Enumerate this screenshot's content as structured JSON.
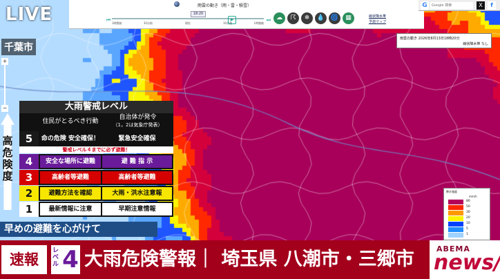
{
  "overlay": {
    "live_label": "LIVE",
    "city_label": "千葉市",
    "vertical_text": [
      "高",
      "危",
      "険",
      "度"
    ],
    "early_evacuation": "早めの避難を心がけて"
  },
  "toolbar": {
    "title": "雨雲の動き（雨・雷・積雪）",
    "time_value": "18:20",
    "time_ticks": [
      "1時間前",
      "",
      "30分前",
      "",
      "",
      "現在",
      "",
      "",
      "30分後",
      "",
      "1時間後"
    ],
    "icons": [
      {
        "name": "rain-cloud-icon",
        "glyph": "☁",
        "style": "green"
      },
      {
        "name": "thunder-cloud-icon",
        "glyph": "☈",
        "style": "dark"
      },
      {
        "name": "snow-depth-icon",
        "glyph": "❄",
        "style": "dark"
      },
      {
        "name": "raindrop-icon",
        "glyph": "💧",
        "style": "dark"
      },
      {
        "name": "typhoon-icon",
        "glyph": "🌀",
        "style": "dark"
      },
      {
        "name": "radar-grid-icon",
        "glyph": "▦",
        "style": "green"
      }
    ],
    "links": [
      "線状降水帯",
      "予測マップ"
    ]
  },
  "search": {
    "placeholder": "Google 検索",
    "google_glyph": "G",
    "x_glyph": "X",
    "facebook_glyph": "f"
  },
  "infobox": {
    "line1": "雨雲の動き  2026年8月13日18時20分",
    "line2": "線状降水帯  なし"
  },
  "warning_table": {
    "title": "大雨警戒レベル",
    "col_action": "住民がとるべき行動",
    "col_authority": "自治体が発令",
    "col_authority_note": "（1，2は気象庁発表）",
    "note": "警戒レベル４までに必ず避難！",
    "rows": [
      {
        "level": "5",
        "action": "命の危険 安全確保！",
        "issued": "緊急安全確保",
        "num_bg": "#1a1a1a",
        "num_fg": "#ffffff",
        "cell_bg": "#111111",
        "cell_fg": "#ffffff"
      },
      {
        "level": "4",
        "action": "安全な場所に避難",
        "issued": "避 難 指 示",
        "num_bg": "#6a1b9a",
        "num_fg": "#ffffff",
        "cell_bg": "#6a1b9a",
        "cell_fg": "#ffffff"
      },
      {
        "level": "3",
        "action": "高齢者等避難",
        "issued": "高齢者等避難",
        "num_bg": "#d50000",
        "num_fg": "#ffffff",
        "cell_bg": "#d50000",
        "cell_fg": "#ffffff"
      },
      {
        "level": "2",
        "action": "避難方法を確認",
        "issued": "大雨・洪水注意報",
        "num_bg": "#f6e600",
        "num_fg": "#111111",
        "cell_bg": "#f6e600",
        "cell_fg": "#111111"
      },
      {
        "level": "1",
        "action": "最新情報に注意",
        "issued": "早期注意情報",
        "num_bg": "#ffffff",
        "num_fg": "#111111",
        "cell_bg": "#ffffff",
        "cell_fg": "#111111"
      }
    ]
  },
  "legend": {
    "title": "降水強度",
    "unit": "mm/h",
    "levels": [
      {
        "label": "80",
        "color": "#b4005a"
      },
      {
        "label": "50",
        "color": "#ff2800"
      },
      {
        "label": "30",
        "color": "#ff9900"
      },
      {
        "label": "20",
        "color": "#faf500"
      },
      {
        "label": "10",
        "color": "#0041ff"
      },
      {
        "label": "5",
        "color": "#218cff"
      },
      {
        "label": "1",
        "color": "#a0d2ff"
      }
    ]
  },
  "ticker": {
    "breaking": "速報",
    "level_word": "レベル",
    "level_number": "4",
    "headline": "大雨危険警報｜ 埼玉県 八潮市・三郷市",
    "brand_top": "ABEMA",
    "brand_bottom": "news/"
  }
}
